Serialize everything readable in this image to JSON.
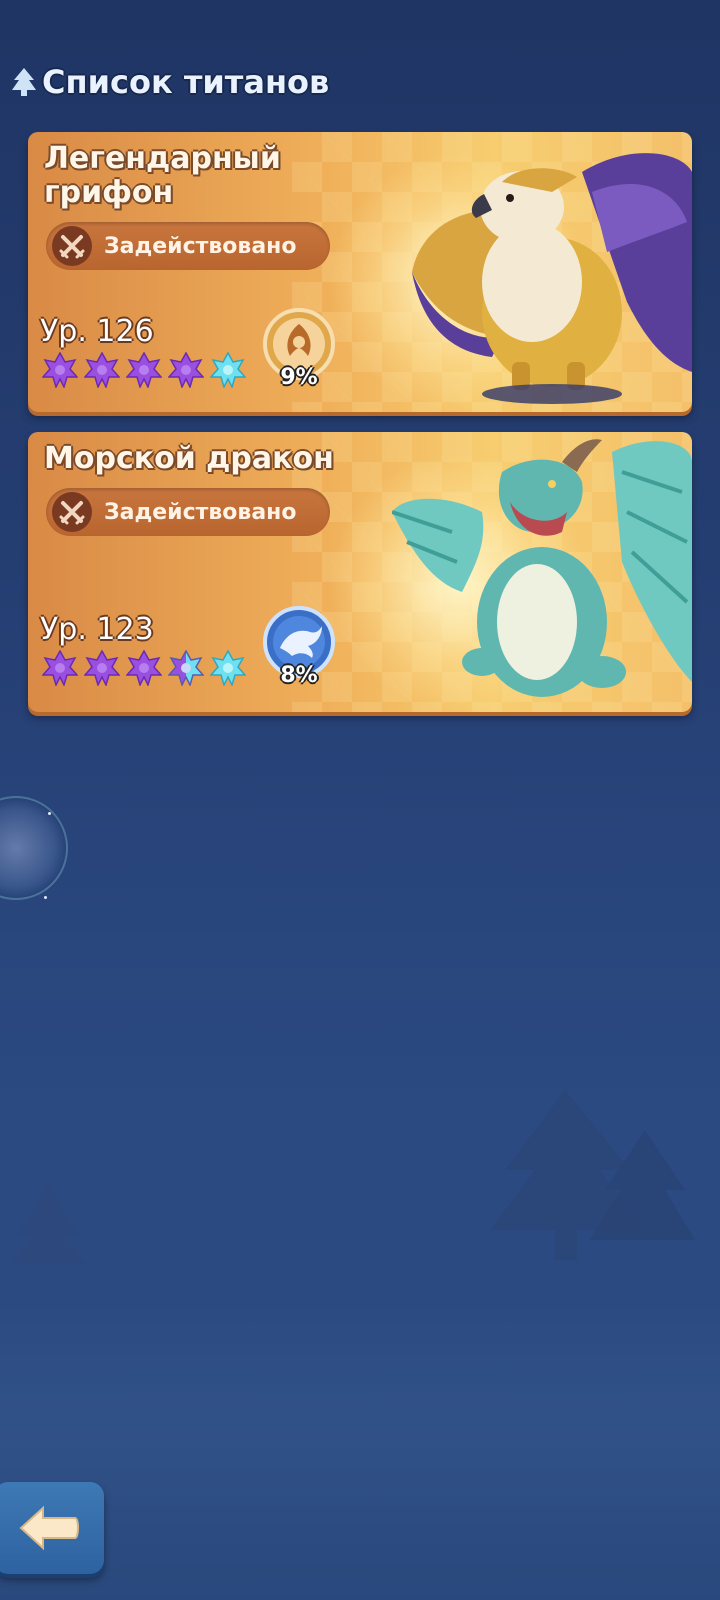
{
  "header": {
    "title": "Список титанов",
    "icon": "tree-icon"
  },
  "titans": [
    {
      "name": "Легендарный грифон",
      "status": "Задействовано",
      "status_icon": "crossed-swords-icon",
      "level": "Ур. 126",
      "stars_total": 5,
      "stars_purple": 4,
      "stars_cyan": 1,
      "element_icon": "phoenix-icon",
      "element_pct": "9%",
      "portrait": "griffin"
    },
    {
      "name": "Морской дракон",
      "status": "Задействовано",
      "status_icon": "crossed-swords-icon",
      "level": "Ур. 123",
      "stars_total": 5,
      "stars_purple": 3,
      "stars_half": 1,
      "stars_cyan": 1,
      "element_icon": "dragon-icon",
      "element_pct": "8%",
      "portrait": "sea-dragon"
    }
  ],
  "navigation": {
    "back_icon": "arrow-left-icon"
  },
  "colors": {
    "background": "#253e72",
    "card": "#f0b05a",
    "star_purple": "#9b4fe0",
    "star_cyan": "#6fe0f0",
    "back_button": "#3d79b5"
  }
}
